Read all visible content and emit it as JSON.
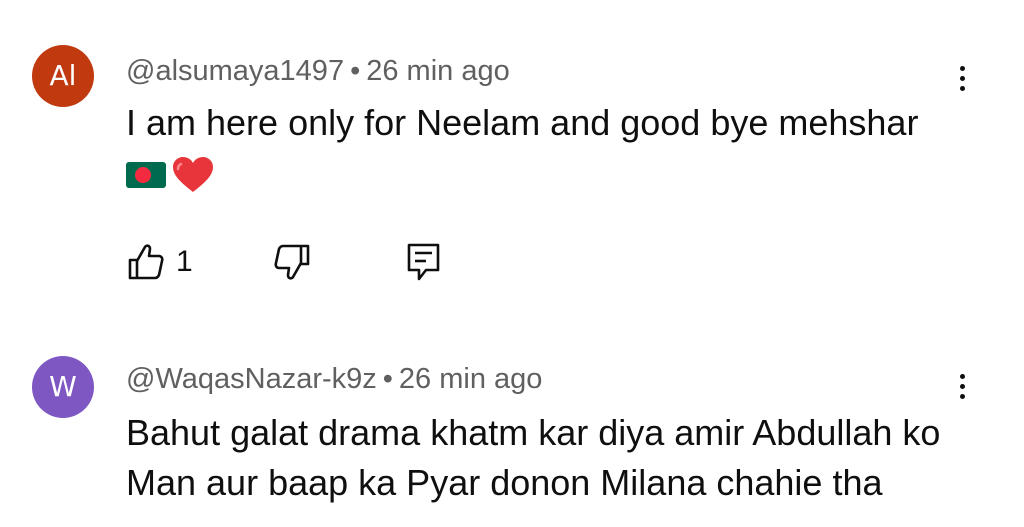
{
  "comments": [
    {
      "avatar_initials": "Al",
      "avatar_color": "#c1390f",
      "handle": "@alsumaya1497",
      "separator": "•",
      "time": "26 min ago",
      "text": "I am here only for Neelam and good bye mehshar",
      "emojis": [
        "bangladesh-flag-icon",
        "red-heart-icon"
      ],
      "like_count": "1"
    },
    {
      "avatar_initials": "W",
      "avatar_color": "#7e57c2",
      "handle": "@WaqasNazar-k9z",
      "separator": "•",
      "time": "26 min ago",
      "text": "Bahut galat drama khatm kar diya amir Abdullah ko Man aur baap ka Pyar donon Milana chahie tha"
    }
  ]
}
